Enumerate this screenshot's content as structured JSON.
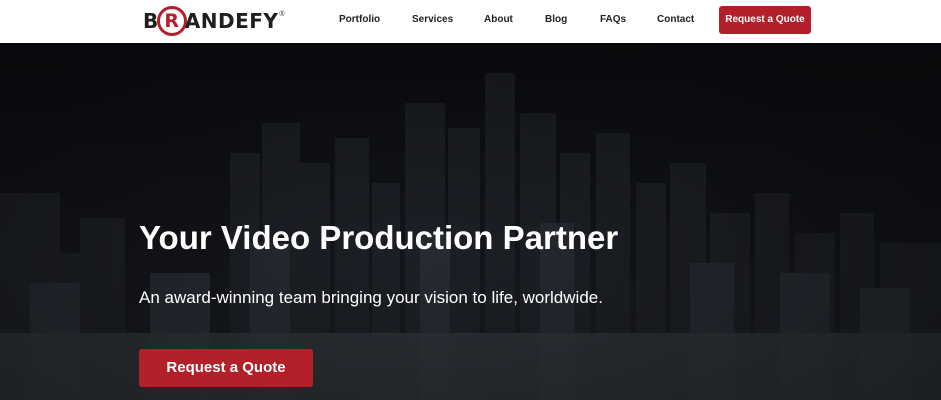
{
  "brand": {
    "logo_prefix": "B",
    "logo_ring": "R",
    "logo_suffix": "ANDEFY",
    "logo_reg": "®",
    "accent": "#b3202a"
  },
  "nav": {
    "items": [
      {
        "label": "Portfolio"
      },
      {
        "label": "Services"
      },
      {
        "label": "About"
      },
      {
        "label": "Blog"
      },
      {
        "label": "FAQs"
      },
      {
        "label": "Contact"
      }
    ],
    "cta_label": "Request a Quote"
  },
  "hero": {
    "title": "Your Video Production Partner",
    "subtitle": "An award-winning team bringing your vision to life, worldwide.",
    "cta_label": "Request a Quote",
    "background": "city-skyline-image"
  }
}
